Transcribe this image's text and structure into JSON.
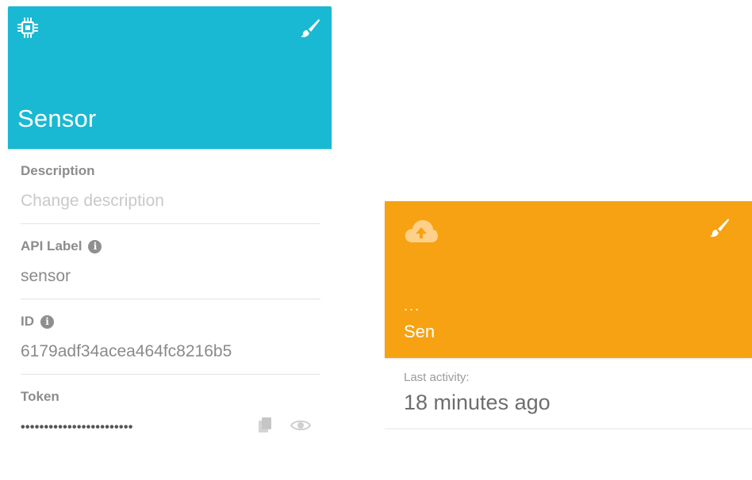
{
  "device": {
    "title": "Sensor",
    "header_color": "#1ab9d3",
    "header_icon": "chip-icon",
    "fields": {
      "description": {
        "label": "Description",
        "placeholder": "Change description"
      },
      "api_label": {
        "label": "API Label",
        "value": "sensor"
      },
      "id": {
        "label": "ID",
        "value": "6179adf34acea464fc8216b5"
      },
      "token": {
        "label": "Token",
        "value": "••••••••••••••••••••••••"
      }
    }
  },
  "variable": {
    "header_color": "#f7a212",
    "header_icon": "cloud-upload-icon",
    "value": "...",
    "name": "Sen",
    "last_activity_label": "Last activity:",
    "last_activity_value": "18 minutes ago"
  },
  "icons": {
    "info": "i"
  }
}
